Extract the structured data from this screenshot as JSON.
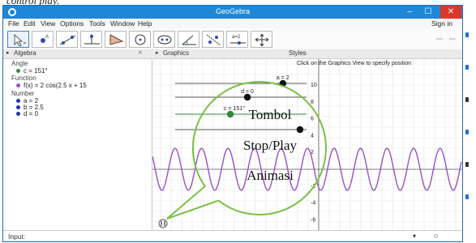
{
  "top_strip": {
    "fragment": "control play."
  },
  "window": {
    "app_title": "GeoGebra",
    "controls": {
      "minimize": "–",
      "maximize": "☐",
      "close": "✕"
    }
  },
  "menu": {
    "items": [
      "File",
      "Edit",
      "View",
      "Options",
      "Tools",
      "Window",
      "Help"
    ],
    "sign_in": "Sign in"
  },
  "toolbar": {
    "tools": [
      "move-icon",
      "point-icon",
      "line-icon",
      "perpendicular-icon",
      "polygon-icon",
      "circle-icon",
      "ellipse-icon",
      "angle-icon",
      "reflect-icon",
      "slider-icon",
      "move-graphics-icon"
    ],
    "undo_icon": "undo-icon",
    "redo_icon": "redo-icon"
  },
  "algebra": {
    "header": "Algebra",
    "categories": {
      "angle": "Angle",
      "function": "Function",
      "number": "Number"
    },
    "angle_item": "c = 151°",
    "function_item": "f(x) = 2 cos(2.5 x + 15",
    "number_items": [
      "a = 2",
      "b = 2.5",
      "d = 0"
    ]
  },
  "graphics": {
    "header": "Graphics",
    "style_bar_label": "Styles",
    "hint": "Click on the Graphics View to specify position",
    "sliders": [
      {
        "label": "a = 2",
        "value": 0.82,
        "color": "#111111"
      },
      {
        "label": "d = 0",
        "value": 0.55,
        "color": "#111111"
      },
      {
        "label": "c = 151°",
        "value": 0.42,
        "color": "#2e8b3a"
      },
      {
        "label": "",
        "value": 0.95,
        "color": "#111111"
      }
    ],
    "y_ticks": [
      "10",
      "8",
      "6",
      "4",
      "2",
      "-2",
      "-4",
      "-6",
      "-8"
    ],
    "curve_color": "#9b4fc4"
  },
  "input_bar": {
    "label": "Input:"
  },
  "callout": {
    "lines": [
      "Tombol",
      "Stop/Play",
      "Animasi"
    ],
    "color": "#7ac043"
  }
}
